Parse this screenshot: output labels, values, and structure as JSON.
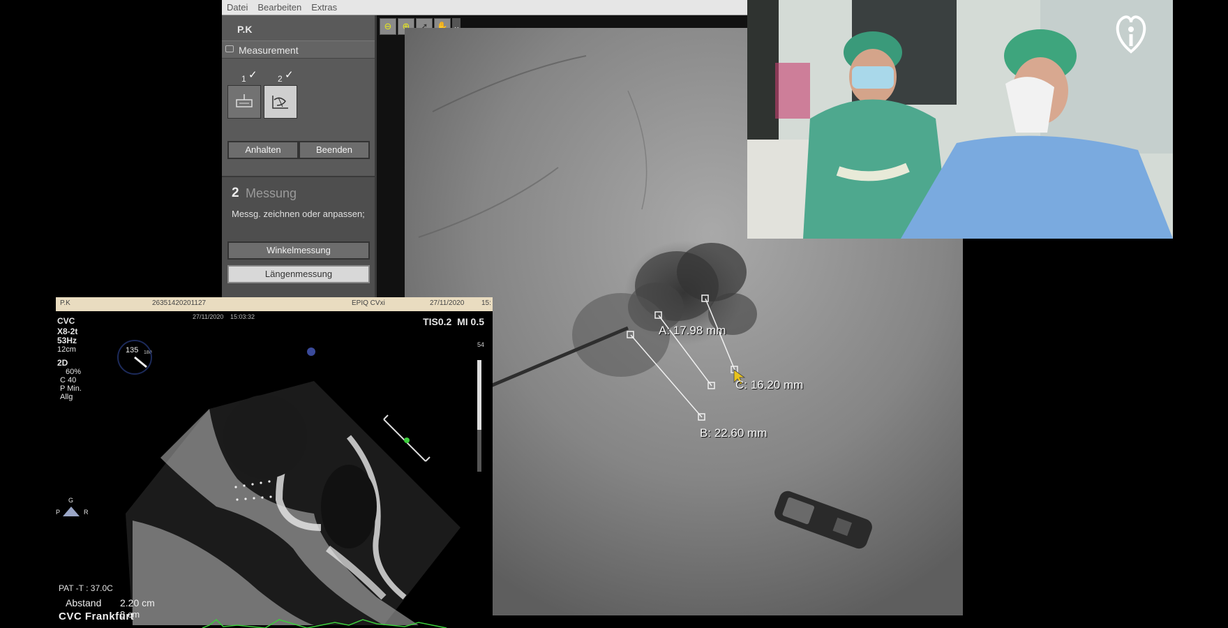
{
  "app": {
    "menu": [
      "Datei",
      "Bearbeiten",
      "Extras"
    ],
    "patient": "P.K",
    "section_title": "Measurement",
    "steps": [
      {
        "number": "1",
        "check": "✓"
      },
      {
        "number": "2",
        "check": "✓"
      }
    ],
    "buttons": {
      "pause": "Anhalten",
      "finish": "Beenden",
      "angle": "Winkelmessung",
      "length": "Längenmessung"
    },
    "step_panel": {
      "number": "2",
      "title": "Messung",
      "description": "Messg. zeichnen oder anpassen;"
    },
    "viewer_tools": [
      "zoom-out-icon",
      "zoom-in-icon",
      "pointer-icon",
      "pan-hand-icon",
      "chevron-down-icon"
    ]
  },
  "fluoro": {
    "measurements": [
      {
        "id": "A",
        "label": "A: 17.98 mm"
      },
      {
        "id": "B",
        "label": "B: 22.60 mm"
      },
      {
        "id": "C",
        "label": "C: 16.20 mm"
      }
    ]
  },
  "echo": {
    "header": {
      "patient": "P.K",
      "id": "26351420201127",
      "device": "EPIQ CVxi",
      "date": "27/11/2020",
      "time": "15:"
    },
    "subheader": {
      "date": "27/11/2020",
      "time": "15:03:32"
    },
    "info_lines": [
      "CVC",
      "X8-2t",
      "53Hz",
      "12cm"
    ],
    "mode_lines": [
      "2D",
      "60%",
      "C 40",
      "P Min.",
      "Allg"
    ],
    "tis": "TIS0.2",
    "mi": "MI 0.5",
    "angle": "135",
    "angle_max": "180",
    "scale_top": "54",
    "orient_top": "G",
    "orient_left": "P",
    "orient_right": "R",
    "pat_temp": "PAT -T : 37.0C",
    "abstand_label": "Abstand",
    "abstand_value": "2.20 cm",
    "abstand2_value": "8 cm"
  },
  "watermark": "CVC Frankfurt",
  "colors": {
    "ecg": "#3ccd3c",
    "cursor": "#e8c21c",
    "logo": "#ffffff"
  }
}
